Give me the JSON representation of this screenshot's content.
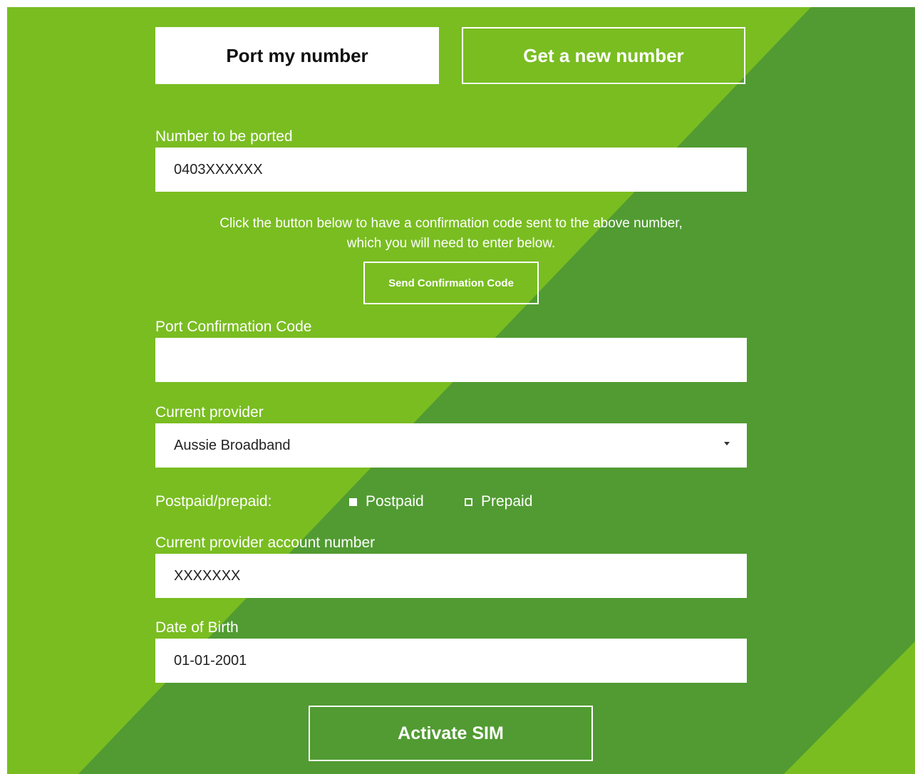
{
  "colors": {
    "light_green": "#79bd21",
    "dark_green": "#519b32",
    "white": "#ffffff"
  },
  "tabs": {
    "port_label": "Port my number",
    "new_label": "Get a new number"
  },
  "number_field": {
    "label": "Number to be ported",
    "value": "0403XXXXXX"
  },
  "info": {
    "line1": "Click the button below to have a confirmation code sent to the above number,",
    "line2": "which you will need to enter below."
  },
  "send_button": {
    "label": "Send Confirmation Code"
  },
  "confirmation_field": {
    "label": "Port Confirmation Code",
    "value": ""
  },
  "provider_field": {
    "label": "Current provider",
    "value": "Aussie Broadband"
  },
  "plan_type": {
    "label": "Postpaid/prepaid:",
    "options": [
      {
        "label": "Postpaid",
        "selected": true
      },
      {
        "label": "Prepaid",
        "selected": false
      }
    ]
  },
  "account_field": {
    "label": "Current provider account number",
    "value": "XXXXXXX"
  },
  "dob_field": {
    "label": "Date of Birth",
    "value": "01-01-2001"
  },
  "activate_button": {
    "label": "Activate SIM"
  }
}
